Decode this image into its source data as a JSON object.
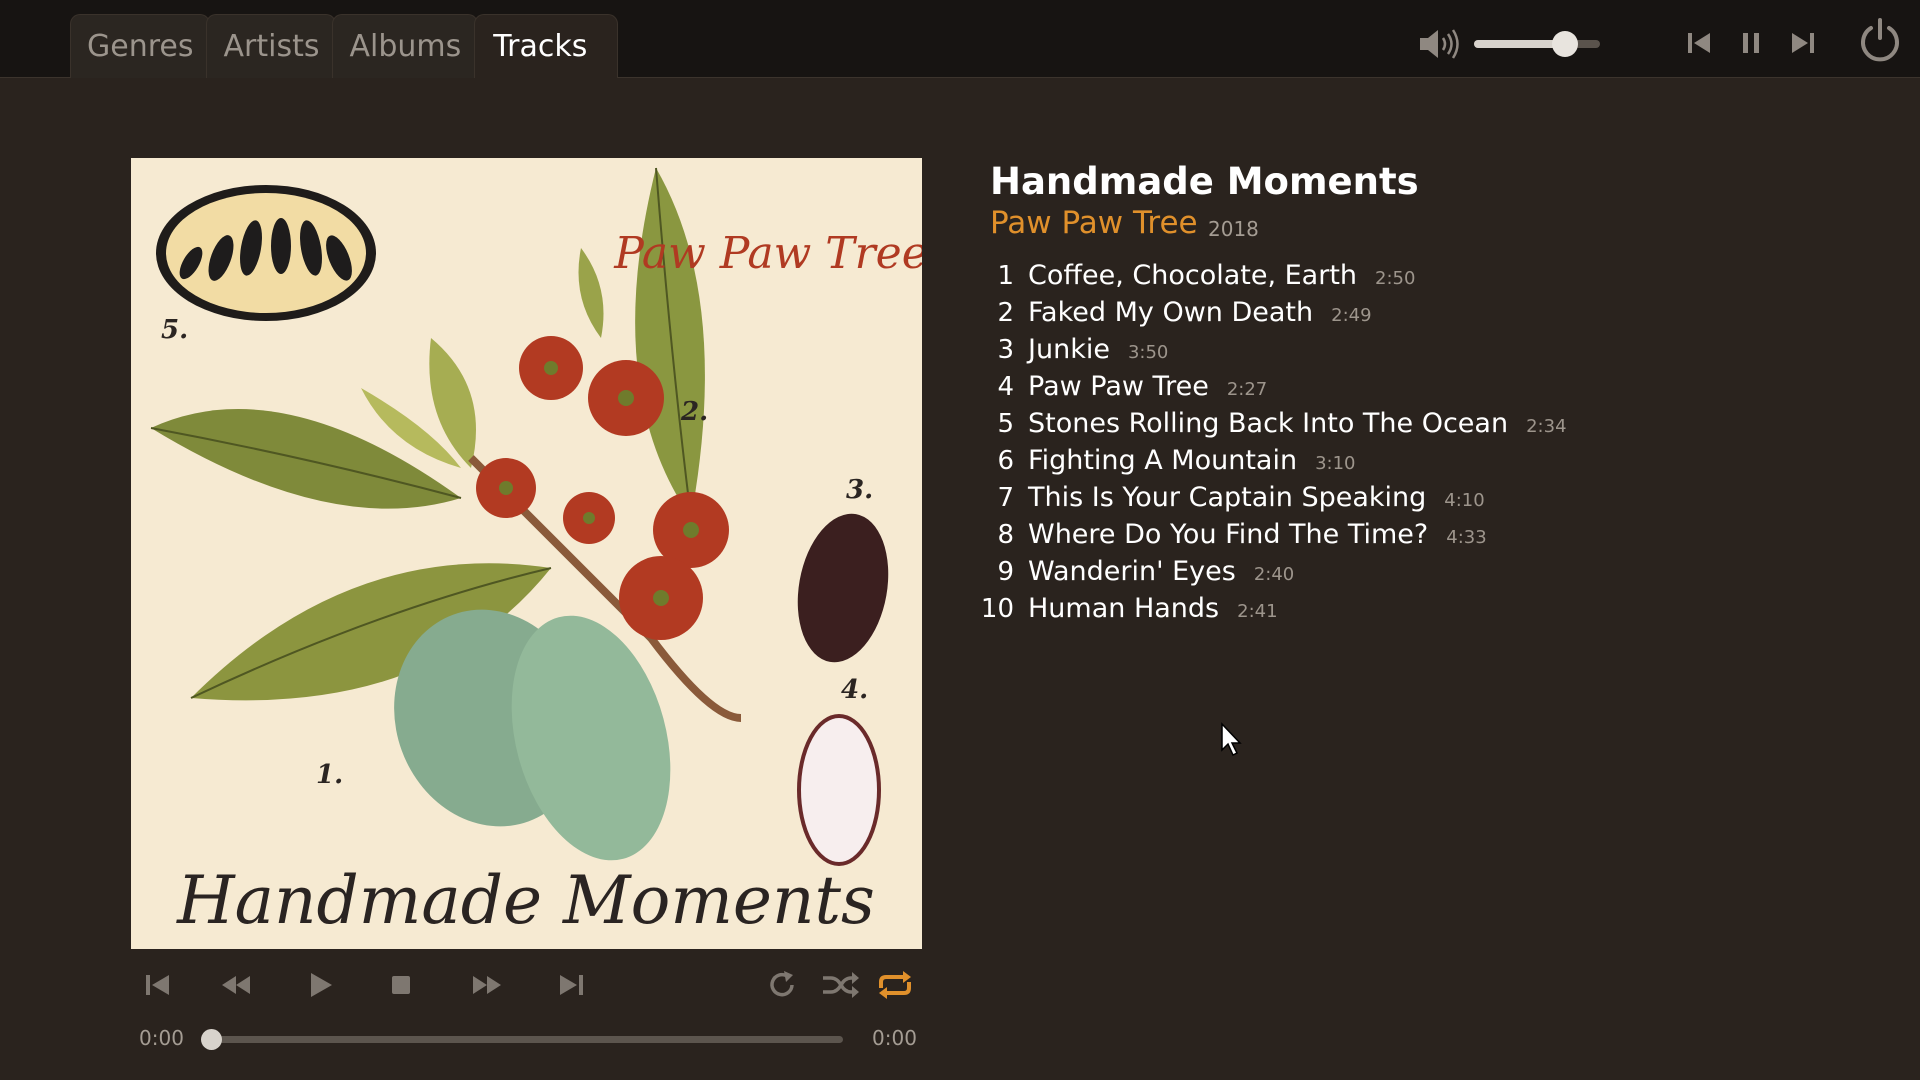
{
  "tabs": [
    "Genres",
    "Artists",
    "Albums",
    "Tracks"
  ],
  "active_tab": "Tracks",
  "volume": {
    "level": 0.72
  },
  "album": {
    "title": "Handmade Moments",
    "artist": "Paw Paw Tree",
    "year": "2018",
    "art_text": {
      "title_script": "Paw Paw Tree",
      "bottom_script": "Handmade Moments",
      "labels": [
        "1.",
        "2.",
        "3.",
        "4.",
        "5."
      ]
    }
  },
  "tracks": [
    {
      "num": "1",
      "title": "Coffee, Chocolate, Earth",
      "duration": "2:50"
    },
    {
      "num": "2",
      "title": "Faked My Own Death",
      "duration": "2:49"
    },
    {
      "num": "3",
      "title": "Junkie",
      "duration": "3:50"
    },
    {
      "num": "4",
      "title": "Paw Paw Tree",
      "duration": "2:27"
    },
    {
      "num": "5",
      "title": "Stones Rolling Back Into The Ocean",
      "duration": "2:34"
    },
    {
      "num": "6",
      "title": "Fighting A Mountain",
      "duration": "3:10"
    },
    {
      "num": "7",
      "title": "This Is Your Captain Speaking",
      "duration": "4:10"
    },
    {
      "num": "8",
      "title": "Where Do You Find The Time?",
      "duration": "4:33"
    },
    {
      "num": "9",
      "title": "Wanderin' Eyes",
      "duration": "2:40"
    },
    {
      "num": "10",
      "title": "Human Hands",
      "duration": "2:41"
    }
  ],
  "player": {
    "elapsed": "0:00",
    "total": "0:00",
    "progress": 0,
    "repeat_active": true
  },
  "colors": {
    "accent": "#e0902b",
    "background": "#2a231e",
    "topbar": "#171412"
  },
  "icons": {
    "top": [
      "volume-icon",
      "previous-icon",
      "pause-icon",
      "next-icon",
      "power-icon"
    ],
    "transport": [
      "skip-back-icon",
      "rewind-icon",
      "play-icon",
      "stop-icon",
      "fast-forward-icon",
      "skip-forward-icon",
      "refresh-icon",
      "shuffle-icon",
      "repeat-icon"
    ]
  }
}
